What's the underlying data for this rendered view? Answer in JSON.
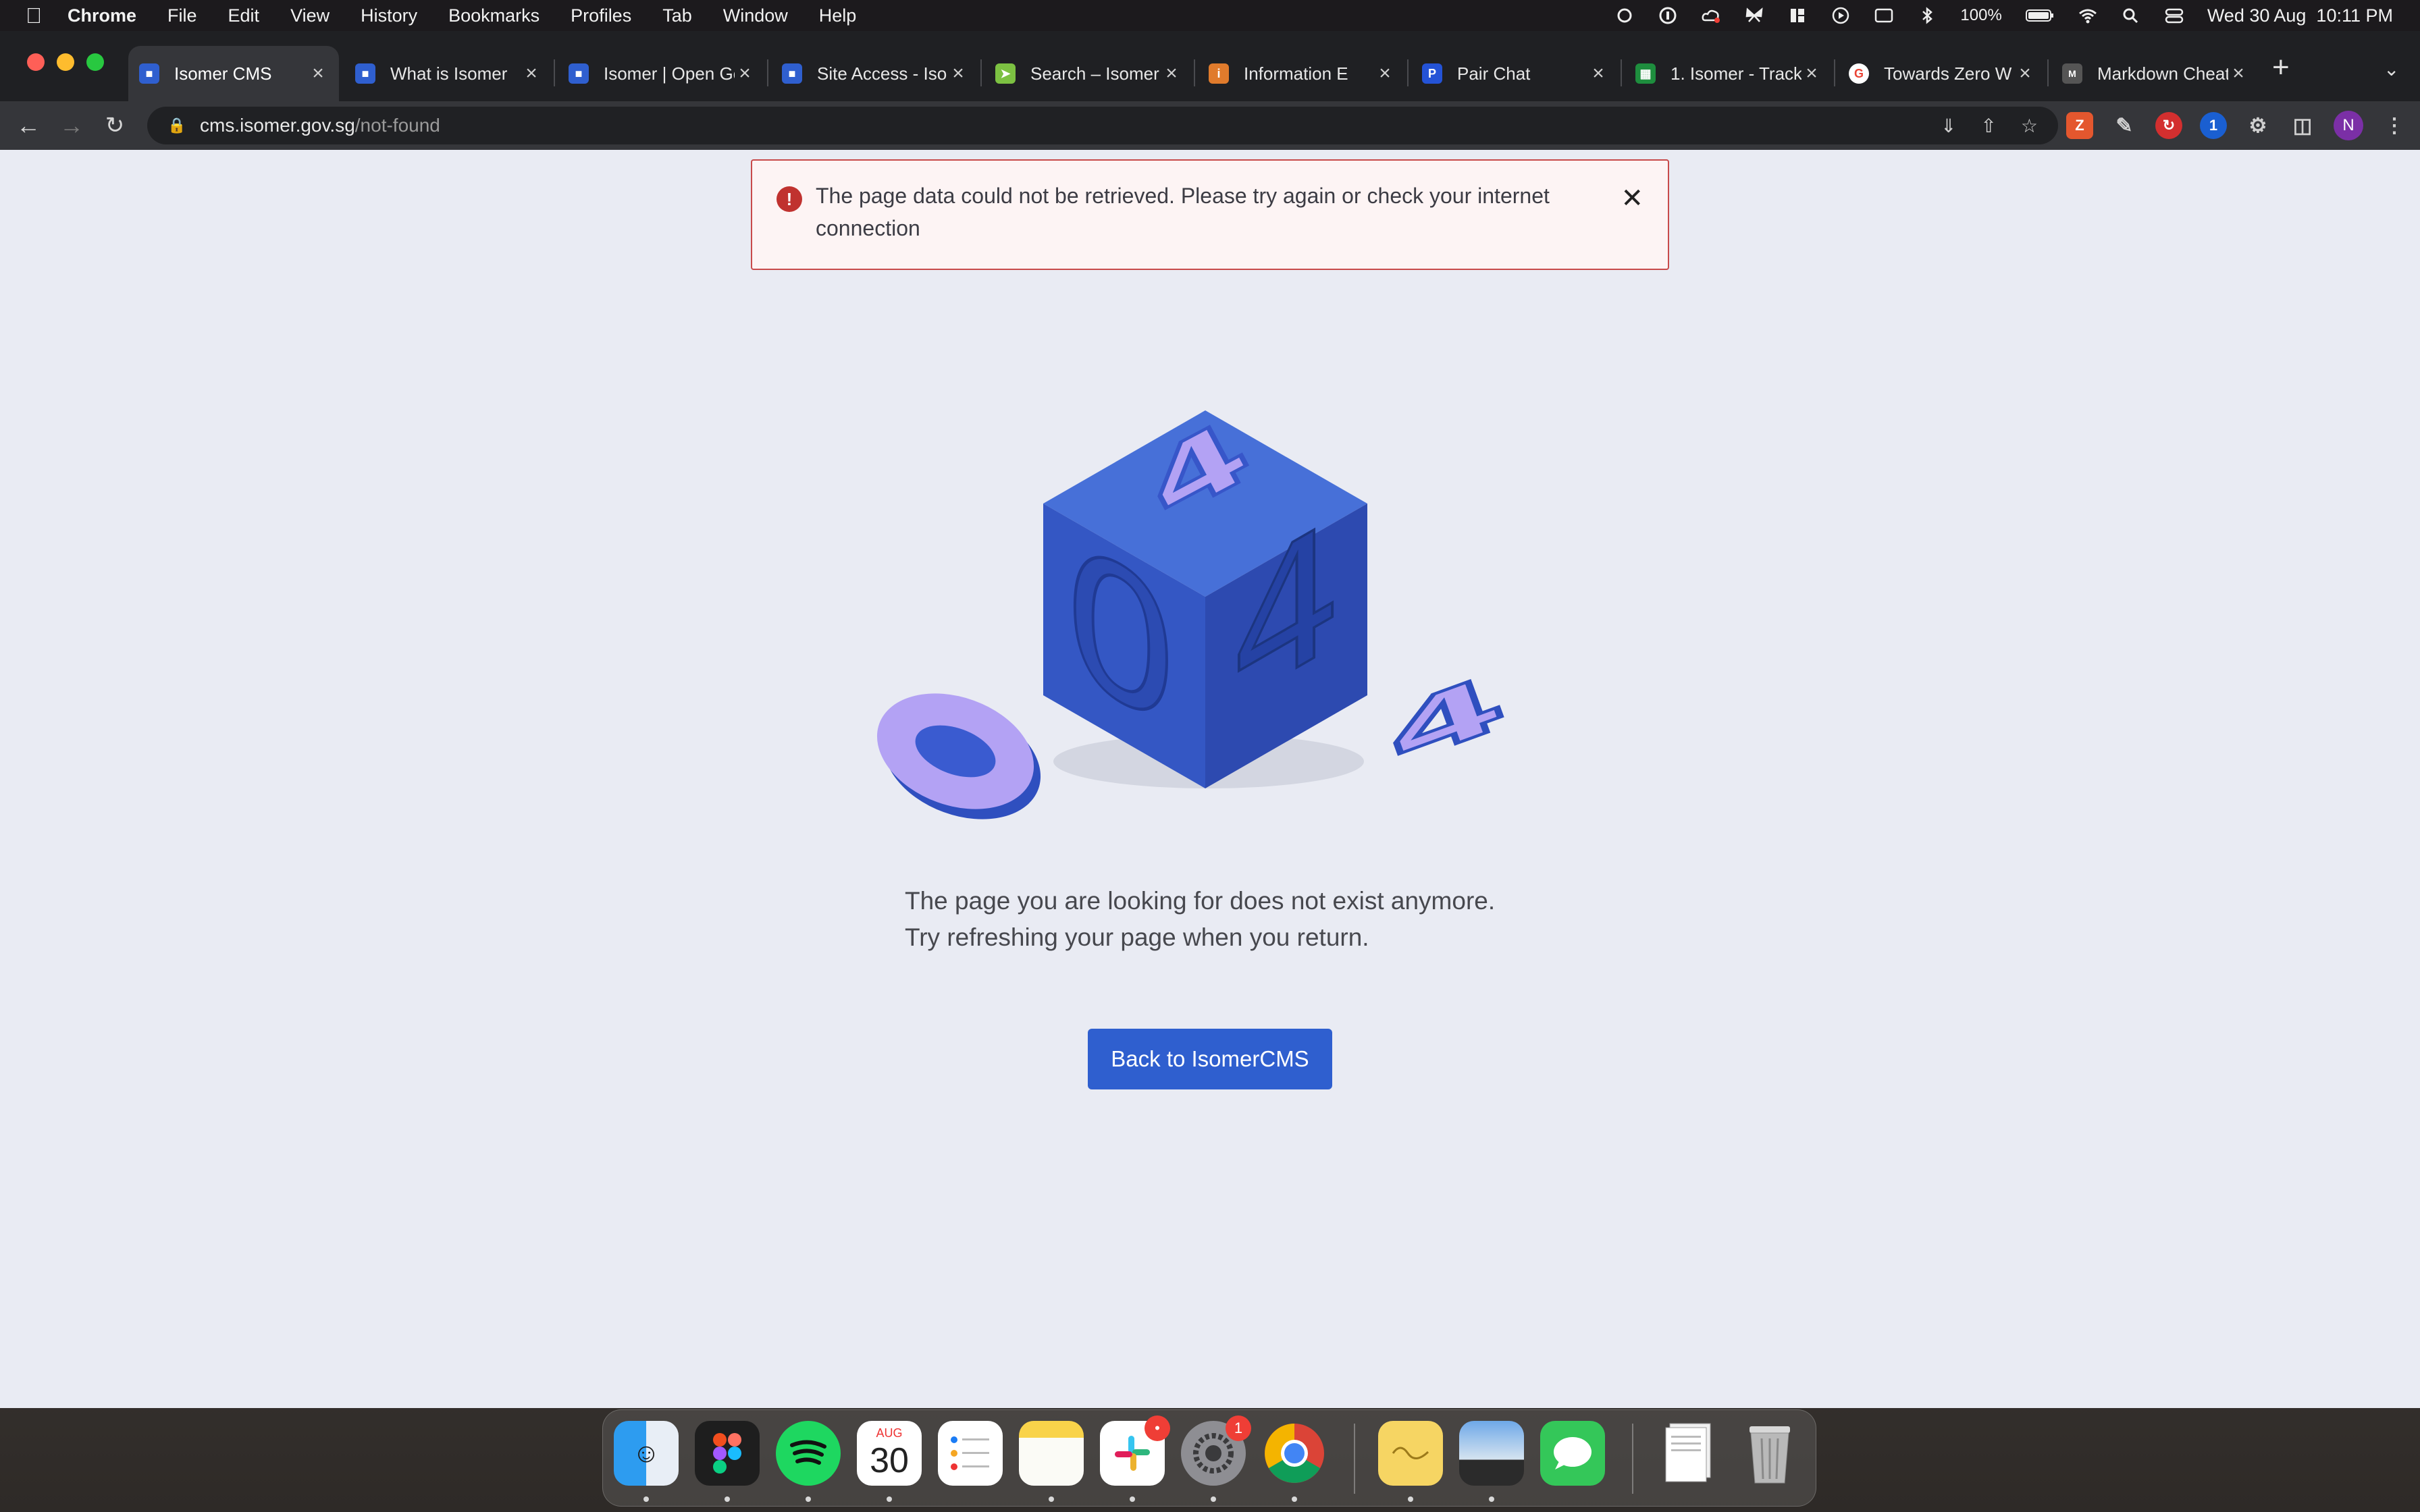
{
  "menubar": {
    "app_name": "Chrome",
    "items": [
      "File",
      "Edit",
      "View",
      "History",
      "Bookmarks",
      "Profiles",
      "Tab",
      "Window",
      "Help"
    ],
    "battery": "100%",
    "datetime": "Wed 30 Aug  10:11 PM"
  },
  "tabs": [
    {
      "title": "Isomer CMS",
      "active": true,
      "favicon_color": "#2f5fcf"
    },
    {
      "title": "What is Isomer",
      "active": false,
      "favicon_color": "#2f5fcf"
    },
    {
      "title": "Isomer | Open Gov",
      "active": false,
      "favicon_color": "#2f5fcf"
    },
    {
      "title": "Site Access - Iso",
      "active": false,
      "favicon_color": "#2f5fcf"
    },
    {
      "title": "Search – Isomer",
      "active": false,
      "favicon_color": "#7cc142"
    },
    {
      "title": "Information E",
      "active": false,
      "favicon_color": "#e07b2c"
    },
    {
      "title": "Pair Chat",
      "active": false,
      "favicon_color": "#2453d6"
    },
    {
      "title": "1. Isomer - Track",
      "active": false,
      "favicon_color": "#1e8e3e"
    },
    {
      "title": "Towards Zero W",
      "active": false,
      "favicon_color": "#ea4335"
    },
    {
      "title": "Markdown Cheat",
      "active": false,
      "favicon_color": "#555555"
    }
  ],
  "omnibox": {
    "host": "cms.isomer.gov.sg",
    "path": "/not-found"
  },
  "profile_initial": "N",
  "alert": {
    "message": "The page data could not be retrieved. Please try again or check your internet connection"
  },
  "illustration": {
    "digits": [
      "0",
      "4",
      "0",
      "4",
      "4"
    ]
  },
  "message": {
    "line1": "The page you are looking for does not exist anymore.",
    "line2": "Try refreshing your page when you return."
  },
  "back_button_label": "Back to IsomerCMS",
  "dock": {
    "calendar_month": "AUG",
    "calendar_day": "30",
    "slack_badge": "•",
    "settings_badge": "1"
  }
}
